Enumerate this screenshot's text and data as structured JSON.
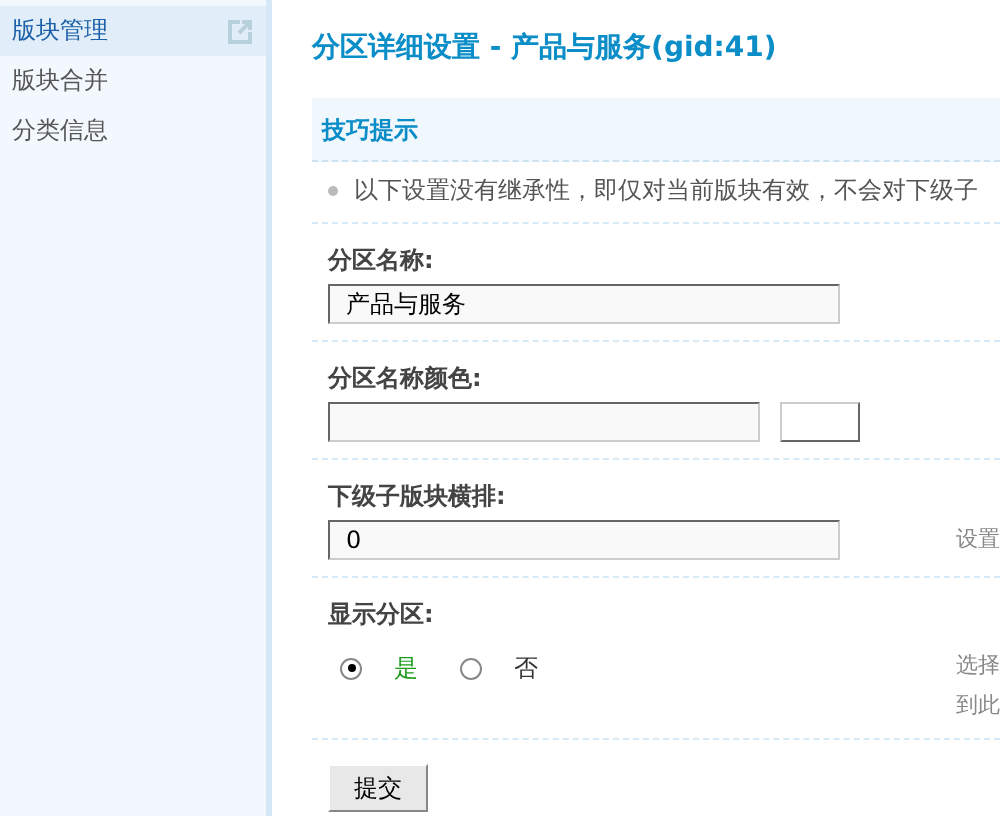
{
  "sidebar": {
    "items": [
      {
        "label": "版块管理",
        "selected": true
      },
      {
        "label": "版块合并",
        "selected": false
      },
      {
        "label": "分类信息",
        "selected": false
      }
    ]
  },
  "page_title": "分区详细设置 - 产品与服务(gid:41)",
  "tips": {
    "title": "技巧提示",
    "items": [
      "以下设置没有继承性，即仅对当前版块有效，不会对下级子"
    ]
  },
  "form": {
    "rows": [
      {
        "kind": "text",
        "label": "分区名称:",
        "value": "产品与服务"
      },
      {
        "kind": "color",
        "label": "分区名称颜色:"
      },
      {
        "kind": "text",
        "label": "下级子版块横排:",
        "value": "0",
        "note": [
          "设置"
        ]
      },
      {
        "kind": "radio",
        "label": "显示分区:",
        "options": [
          {
            "label": "是",
            "selected": true
          },
          {
            "label": "否",
            "selected": false
          }
        ],
        "note": [
          "选择",
          "到此"
        ]
      }
    ],
    "submit": "提交"
  }
}
